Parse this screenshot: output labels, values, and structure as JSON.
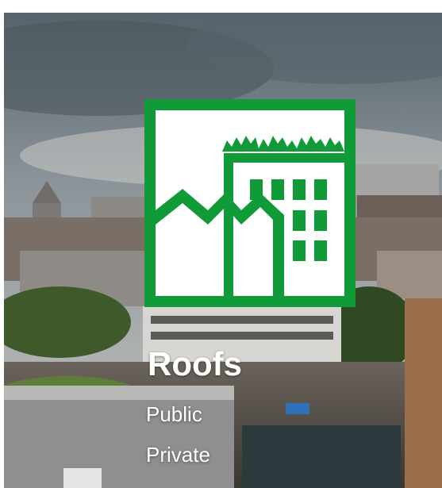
{
  "category": {
    "icon": "green-roof-building-icon",
    "title": "Roofs",
    "links": [
      {
        "label": "Public"
      },
      {
        "label": "Private"
      }
    ]
  },
  "colors": {
    "brand_green": "#109a38",
    "text": "#ffffff"
  }
}
